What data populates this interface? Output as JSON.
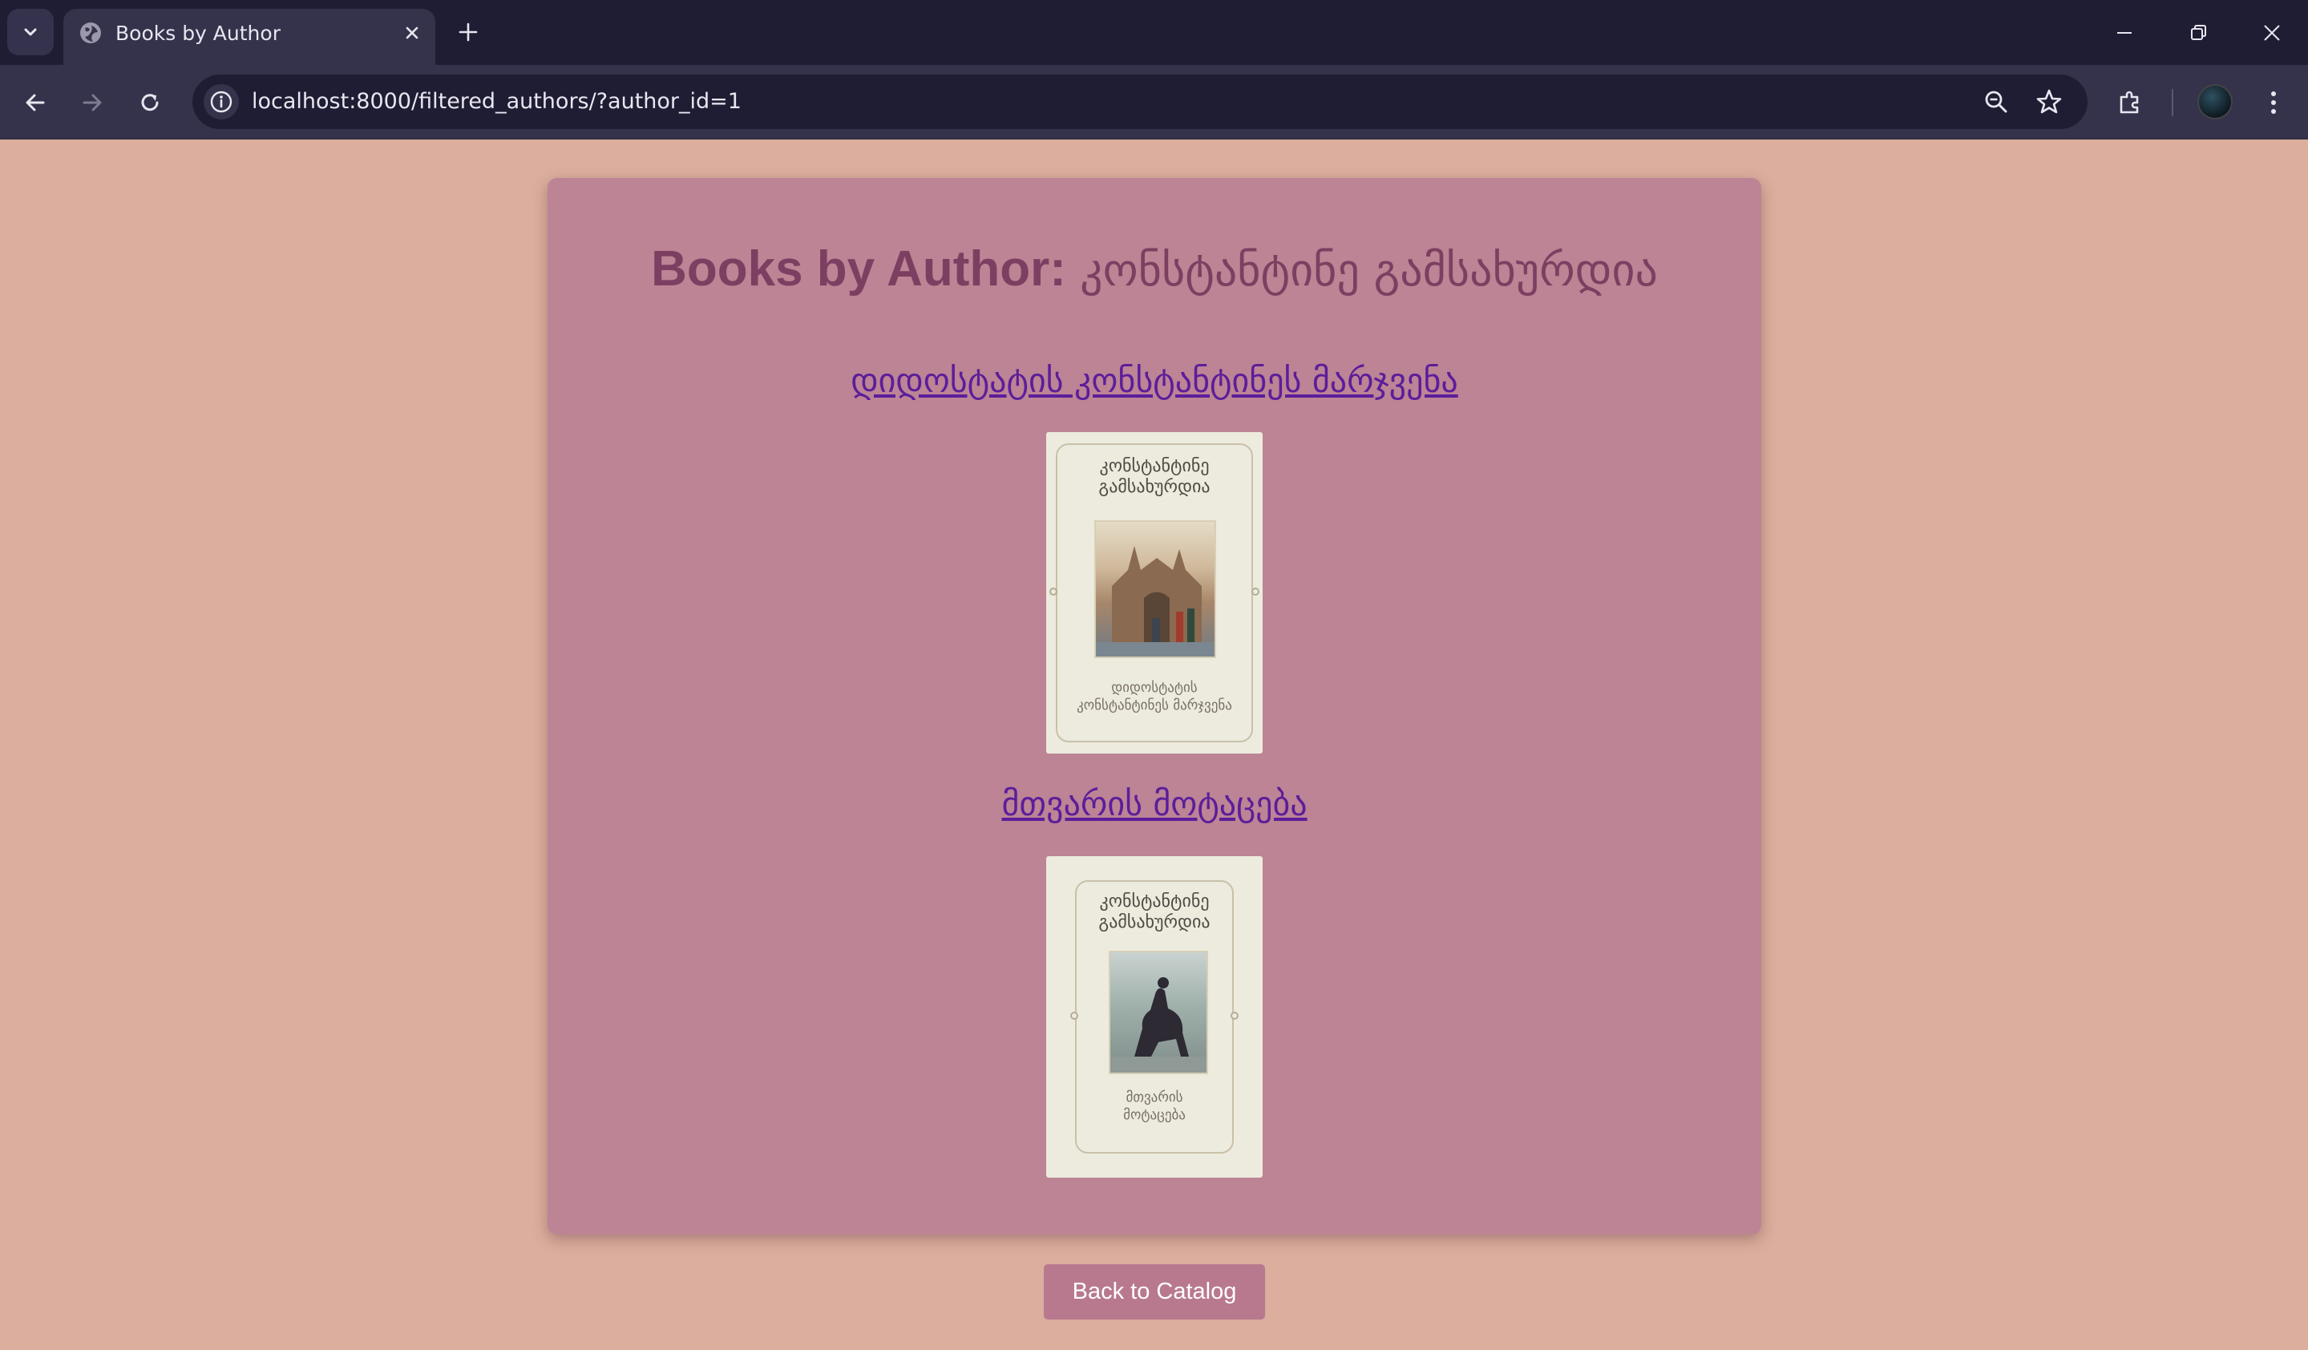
{
  "browser": {
    "tab_title": "Books by Author",
    "url": "localhost:8000/filtered_authors/?author_id=1"
  },
  "page": {
    "heading_prefix": "Books by Author:",
    "author_name": "კონსტანტინე გამსახურდია",
    "books": [
      {
        "title": "დიდოსტატის კონსტანტინეს მარჯვენა",
        "cover_author_text": [
          "კონსტანტინე",
          "გამსახურდია"
        ],
        "cover_title_text": [
          "დიდოსტატის",
          "კონსტანტინეს მარჯვენა"
        ]
      },
      {
        "title": "მთვარის მოტაცება",
        "cover_author_text": [
          "კონსტანტინე",
          "გამსახურდია"
        ],
        "cover_title_text": [
          "მთვარის",
          "მოტაცება"
        ]
      }
    ],
    "back_button_label": "Back to Catalog"
  },
  "icons": {
    "favicon": "globe-icon",
    "tab_list": "chevron-down-icon",
    "tab_close": "close-icon",
    "new_tab": "plus-icon",
    "back": "arrow-left-icon",
    "forward": "arrow-right-icon",
    "reload": "reload-icon",
    "site_info": "info-icon",
    "zoom": "zoom-out-icon",
    "bookmark": "star-icon",
    "extensions": "puzzle-icon",
    "menu": "kebab-menu-icon"
  },
  "colors": {
    "page_background": "#dbae9d",
    "card_background": "#bc8494",
    "heading": "#7d3f61",
    "link": "#5c1d9b",
    "button": "#b8798e",
    "chrome_dark": "#1f1d33",
    "chrome_toolbar": "#35334b"
  }
}
